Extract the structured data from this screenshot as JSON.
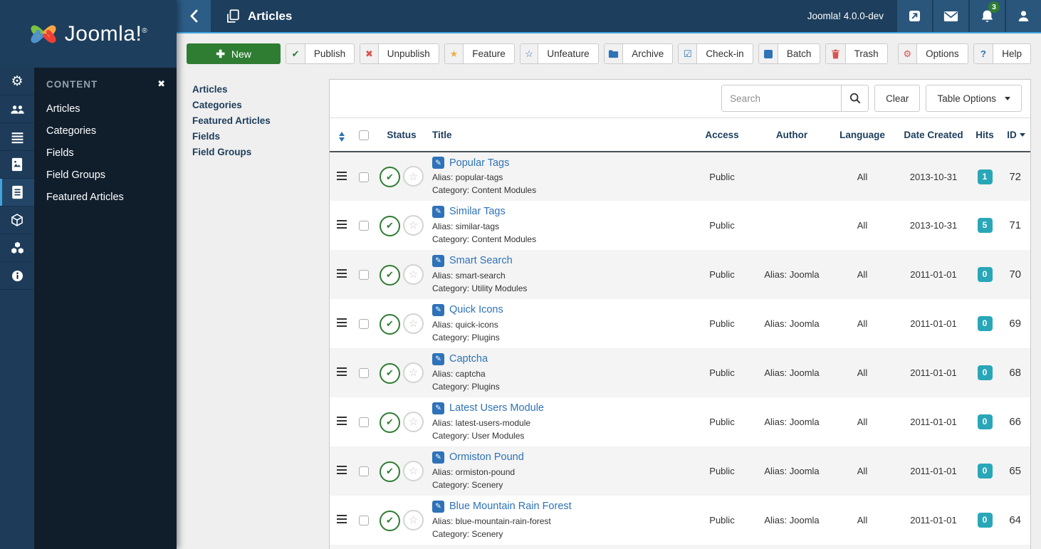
{
  "colors": {
    "navy": "#1d3e5c",
    "accent_blue": "#41a3dc",
    "green": "#2f7d33",
    "red": "#d9534f",
    "orange": "#f0ad4e",
    "link_blue": "#2e72b8",
    "teal_badge": "#29a7b8"
  },
  "logo": {
    "text": "Joomla!",
    "registered": "®"
  },
  "header": {
    "title": "Articles",
    "version": "Joomla! 4.0.0-dev",
    "notification_count": "3"
  },
  "toolbar": {
    "new": "New",
    "publish": "Publish",
    "unpublish": "Unpublish",
    "feature": "Feature",
    "unfeature": "Unfeature",
    "archive": "Archive",
    "checkin": "Check-in",
    "batch": "Batch",
    "trash": "Trash",
    "options": "Options",
    "help": "Help"
  },
  "sidebar": {
    "heading": "CONTENT",
    "menu_items": [
      "Articles",
      "Categories",
      "Fields",
      "Field Groups",
      "Featured Articles"
    ]
  },
  "submenu": {
    "items": [
      "Articles",
      "Categories",
      "Featured Articles",
      "Fields",
      "Field Groups"
    ]
  },
  "filters": {
    "search_placeholder": "Search",
    "clear": "Clear",
    "table_options": "Table Options"
  },
  "table": {
    "headers": {
      "status": "Status",
      "title": "Title",
      "access": "Access",
      "author": "Author",
      "language": "Language",
      "date_created": "Date Created",
      "hits": "Hits",
      "id": "ID"
    },
    "rows": [
      {
        "title": "Popular Tags",
        "alias_label": "Alias: popular-tags",
        "category_label": "Category: Content Modules",
        "access": "Public",
        "author": "",
        "language": "All",
        "date_created": "2013-10-31",
        "hits": "1",
        "id": "72"
      },
      {
        "title": "Similar Tags",
        "alias_label": "Alias: similar-tags",
        "category_label": "Category: Content Modules",
        "access": "Public",
        "author": "",
        "language": "All",
        "date_created": "2013-10-31",
        "hits": "5",
        "id": "71"
      },
      {
        "title": "Smart Search",
        "alias_label": "Alias: smart-search",
        "category_label": "Category: Utility Modules",
        "access": "Public",
        "author": "Alias: Joomla",
        "language": "All",
        "date_created": "2011-01-01",
        "hits": "0",
        "id": "70"
      },
      {
        "title": "Quick Icons",
        "alias_label": "Alias: quick-icons",
        "category_label": "Category: Plugins",
        "access": "Public",
        "author": "Alias: Joomla",
        "language": "All",
        "date_created": "2011-01-01",
        "hits": "0",
        "id": "69"
      },
      {
        "title": "Captcha",
        "alias_label": "Alias: captcha",
        "category_label": "Category: Plugins",
        "access": "Public",
        "author": "Alias: Joomla",
        "language": "All",
        "date_created": "2011-01-01",
        "hits": "0",
        "id": "68"
      },
      {
        "title": "Latest Users Module",
        "alias_label": "Alias: latest-users-module",
        "category_label": "Category: User Modules",
        "access": "Public",
        "author": "Alias: Joomla",
        "language": "All",
        "date_created": "2011-01-01",
        "hits": "0",
        "id": "66"
      },
      {
        "title": "Ormiston Pound",
        "alias_label": "Alias: ormiston-pound",
        "category_label": "Category: Scenery",
        "access": "Public",
        "author": "Alias: Joomla",
        "language": "All",
        "date_created": "2011-01-01",
        "hits": "0",
        "id": "65"
      },
      {
        "title": "Blue Mountain Rain Forest",
        "alias_label": "Alias: blue-mountain-rain-forest",
        "category_label": "Category: Scenery",
        "access": "Public",
        "author": "Alias: Joomla",
        "language": "All",
        "date_created": "2011-01-01",
        "hits": "0",
        "id": "64"
      }
    ]
  }
}
